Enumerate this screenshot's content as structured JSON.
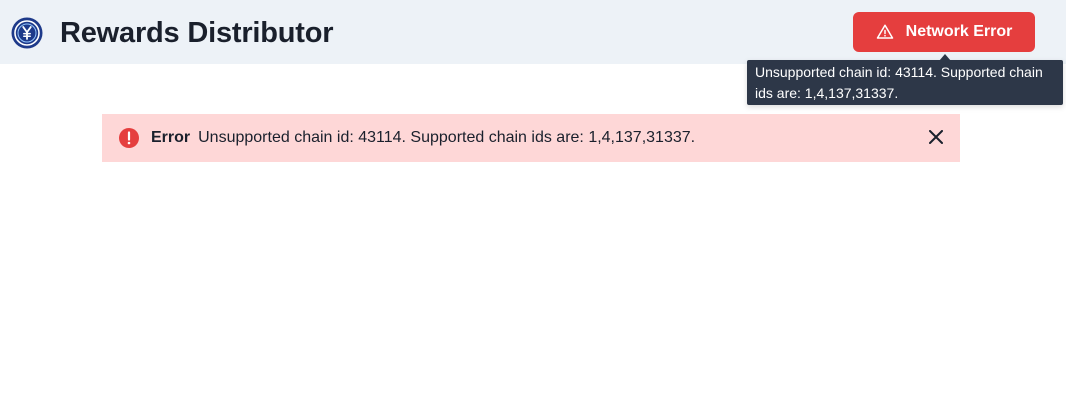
{
  "header": {
    "title": "Rewards Distributor",
    "logo_icon": "yen-coin-icon",
    "network_button": {
      "label": "Network Error",
      "icon": "warning-triangle-icon",
      "color": "#e53e3e"
    },
    "tooltip": {
      "text": "Unsupported chain id: 43114. Supported chain ids are: 1,4,137,31337."
    }
  },
  "alert": {
    "status": "error",
    "icon": "error-circle-icon",
    "title": "Error",
    "description": "Unsupported chain id: 43114. Supported chain ids are: 1,4,137,31337.",
    "close_icon": "close-icon",
    "background": "#fed7d7"
  }
}
